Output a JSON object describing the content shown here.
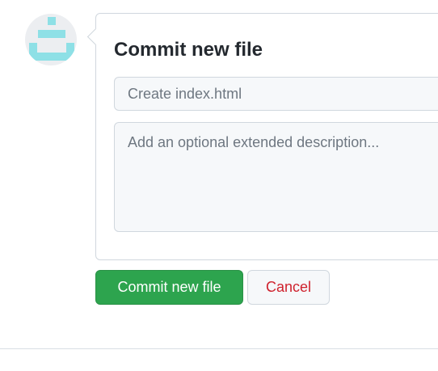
{
  "commit_form": {
    "title": "Commit new file",
    "summary_placeholder": "Create index.html",
    "description_placeholder": "Add an optional extended description..."
  },
  "buttons": {
    "commit_label": "Commit new file",
    "cancel_label": "Cancel"
  },
  "avatar": {
    "icon": "identicon",
    "color": "#8ee0e6",
    "background": "#eceef1"
  },
  "colors": {
    "primary": "#2da44e",
    "danger": "#cf222e",
    "border": "#d0d7de",
    "input_bg": "#f6f8fa",
    "text": "#24292f"
  }
}
